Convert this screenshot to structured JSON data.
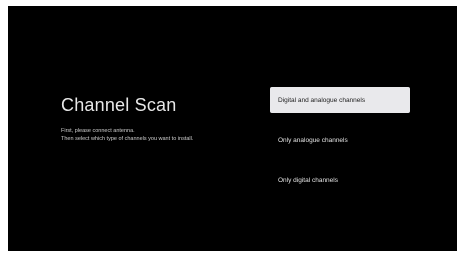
{
  "screen": {
    "title": "Channel Scan",
    "description_lines": [
      "First, please connect antenna.",
      "Then select which type of channels you want to install."
    ]
  },
  "options": [
    {
      "label": "Digital and analogue channels",
      "selected": true
    },
    {
      "label": "Only analogue channels",
      "selected": false
    },
    {
      "label": "Only digital channels",
      "selected": false
    }
  ],
  "colors": {
    "background": "#000000",
    "selected_bg": "#e9e9ec",
    "text": "#e6e6e6"
  }
}
